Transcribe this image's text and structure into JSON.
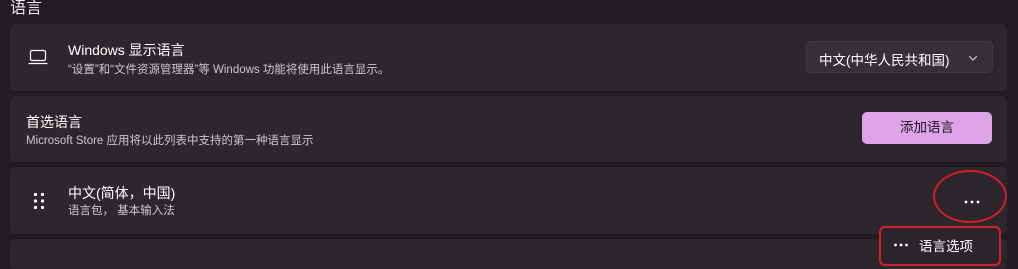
{
  "section_title": "语言",
  "display_language": {
    "title": "Windows 显示语言",
    "description": "“设置”和“文件资源管理器”等 Windows 功能将使用此语言显示。",
    "selected": "中文(中华人民共和国)",
    "icon": "monitor-icon"
  },
  "preferred_languages": {
    "title": "首选语言",
    "description": "Microsoft Store 应用将以此列表中支持的第一种语言显示",
    "add_button": "添加语言"
  },
  "language_item": {
    "name": "中文(简体，中国)",
    "details": "语言包， 基本输入法",
    "more_icon": "more-horizontal-icon",
    "grip_icon": "drag-handle-icon"
  },
  "context_menu": {
    "option_label": "语言选项",
    "icon": "more-horizontal-icon"
  },
  "colors": {
    "background": "#221c22",
    "card": "#2d272d",
    "accent": "#dda4e8",
    "annotation": "#d21e2a"
  }
}
